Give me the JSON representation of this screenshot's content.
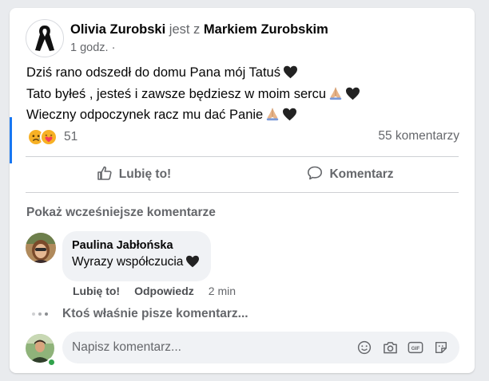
{
  "post": {
    "author": "Olivia Zurobski",
    "with_text": "jest z",
    "tagged": "Markiem Zurobskim",
    "time": "1 godz.",
    "separator": "·",
    "lines": [
      "Dziś rano odszedł do domu Pana mój Tatuś",
      "Tato byłeś , jesteś i zawsze będziesz w moim sercu",
      "Wieczny odpoczynek racz mu dać Panie"
    ],
    "icons": {
      "avatar": "black-ribbon-icon",
      "heart": "black-heart-icon",
      "hands": "folded-hands-icon",
      "privacy": "globe-icon"
    }
  },
  "reactions": {
    "count": "51",
    "types": [
      "sad-reaction-icon",
      "care-reaction-icon"
    ],
    "comments_count": "55 komentarzy"
  },
  "actions": {
    "like": "Lubię to!",
    "comment": "Komentarz"
  },
  "comments": {
    "show_previous": "Pokaż wcześniejsze komentarze",
    "items": [
      {
        "author": "Paulina Jabłońska",
        "text": "Wyrazy współczucia",
        "like": "Lubię to!",
        "reply": "Odpowiedz",
        "time": "2 min"
      }
    ],
    "typing": "Ktoś właśnie pisze komentarz..."
  },
  "composer": {
    "placeholder": "Napisz komentarz...",
    "icons": [
      "emoji-icon",
      "camera-icon",
      "gif-icon",
      "sticker-icon"
    ]
  },
  "colors": {
    "accent": "#1877f2",
    "secondary_text": "#65676b",
    "bubble": "#f0f2f5",
    "online": "#31a24c"
  }
}
